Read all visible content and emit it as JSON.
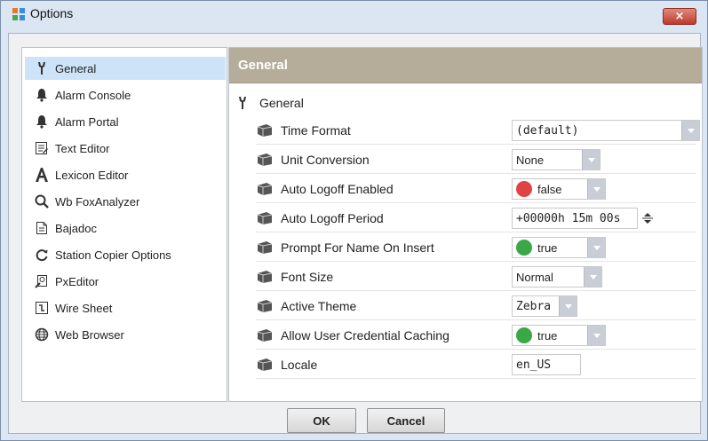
{
  "window": {
    "title": "Options",
    "close_glyph": "×"
  },
  "sidebar": {
    "items": [
      {
        "label": "General",
        "icon": "wrench-icon",
        "selected": true
      },
      {
        "label": "Alarm Console",
        "icon": "bell-icon",
        "selected": false
      },
      {
        "label": "Alarm Portal",
        "icon": "bell-icon",
        "selected": false
      },
      {
        "label": "Text Editor",
        "icon": "text-editor-icon",
        "selected": false
      },
      {
        "label": "Lexicon Editor",
        "icon": "letter-a-icon",
        "selected": false
      },
      {
        "label": "Wb FoxAnalyzer",
        "icon": "magnifier-icon",
        "selected": false
      },
      {
        "label": "Bajadoc",
        "icon": "document-icon",
        "selected": false
      },
      {
        "label": "Station Copier Options",
        "icon": "refresh-icon",
        "selected": false
      },
      {
        "label": "PxEditor",
        "icon": "px-editor-icon",
        "selected": false
      },
      {
        "label": "Wire Sheet",
        "icon": "wire-sheet-icon",
        "selected": false
      },
      {
        "label": "Web Browser",
        "icon": "globe-icon",
        "selected": false
      }
    ]
  },
  "main": {
    "header": "General",
    "tree_root": "General",
    "properties": [
      {
        "label": "Time Format",
        "value": "(default)",
        "kind": "combo-mono"
      },
      {
        "label": "Unit Conversion",
        "value": "None",
        "kind": "combo"
      },
      {
        "label": "Auto Logoff Enabled",
        "value": "false",
        "kind": "bool",
        "color": "#e04343"
      },
      {
        "label": "Auto Logoff Period",
        "value": "+00000h 15m 00s",
        "kind": "duration"
      },
      {
        "label": "Prompt For Name On Insert",
        "value": "true",
        "kind": "bool",
        "color": "#3aa846"
      },
      {
        "label": "Font Size",
        "value": "Normal",
        "kind": "combo"
      },
      {
        "label": "Active Theme",
        "value": "Zebra",
        "kind": "combo-mono"
      },
      {
        "label": "Allow User Credential Caching",
        "value": "true",
        "kind": "bool",
        "color": "#3aa846"
      },
      {
        "label": "Locale",
        "value": "en_US",
        "kind": "text-mono"
      }
    ]
  },
  "buttons": {
    "ok": "OK",
    "cancel": "Cancel"
  },
  "colors": {
    "header_bg": "#b5ad9a",
    "selected_bg": "#cde3f7",
    "false_dot": "#e04343",
    "true_dot": "#3aa846"
  }
}
